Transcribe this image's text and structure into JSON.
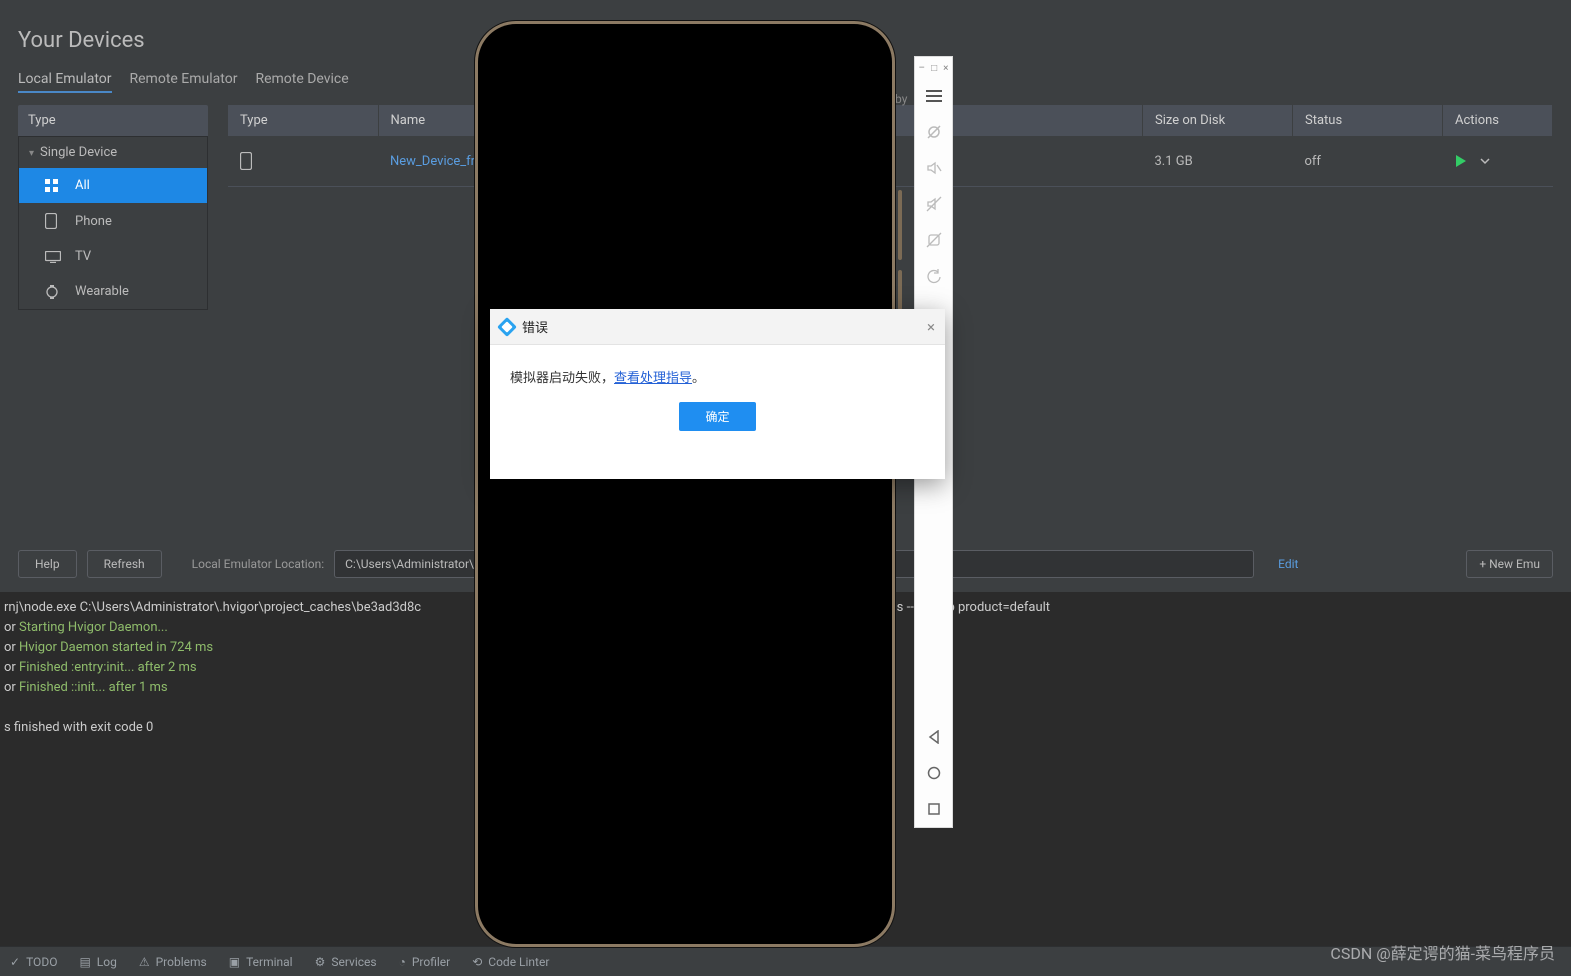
{
  "title": "Your Devices",
  "tabs": {
    "local": "Local Emulator",
    "remote_emu": "Remote Emulator",
    "remote_dev": "Remote Device"
  },
  "sidebar": {
    "type_header": "Type",
    "group": "Single Device",
    "items": [
      {
        "label": "All"
      },
      {
        "label": "Phone"
      },
      {
        "label": "TV"
      },
      {
        "label": "Wearable"
      }
    ]
  },
  "table": {
    "headers": {
      "type": "Type",
      "name": "Name",
      "size": "Size on Disk",
      "status": "Status",
      "actions": "Actions"
    },
    "row": {
      "name": "New_Device_fro",
      "size": "3.1 GB",
      "status": "off"
    }
  },
  "footer": {
    "help": "Help",
    "refresh": "Refresh",
    "loc_label": "Local Emulator Location:",
    "loc_value": "C:\\Users\\Administrator\\AppD",
    "edit": "Edit",
    "new_btn": "+   New Emu"
  },
  "dialog": {
    "title": "错误",
    "msg_prefix": "模拟器启动失败，",
    "msg_link": "查看处理指导",
    "msg_suffix": "。",
    "ok": "确定"
  },
  "console": {
    "l0a": "rnj\\node.exe C:\\Users\\Administrator\\.hvigor\\project_caches\\be3ad3d8c",
    "l0b": "or\\h       igor.js --sync -p product=default",
    "p": "or ",
    "l1": "Starting Hvigor Daemon...",
    "l2": "Hvigor Daemon started in 724 ms",
    "l3": "Finished :entry:init... after 2 ms",
    "l4": "Finished ::init... after 1 ms",
    "l6": "s finished with exit code 0"
  },
  "statusbar": {
    "todo": "TODO",
    "log": "Log",
    "problems": "Problems",
    "terminal": "Terminal",
    "services": "Services",
    "profiler": "Profiler",
    "codelinter": "Code Linter"
  },
  "hint_r": "r by",
  "watermark": "CSDN @薛定谔的猫-菜鸟程序员"
}
